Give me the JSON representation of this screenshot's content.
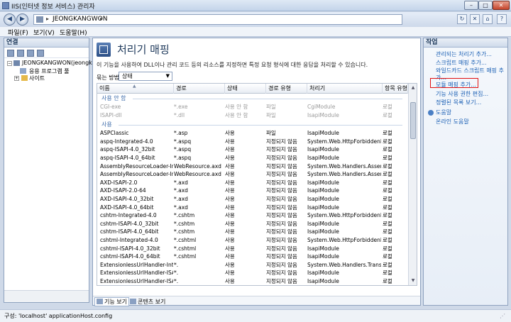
{
  "window": {
    "title": "IIS(인터넷 정보 서비스) 관리자"
  },
  "address": {
    "path": "JEONGKANGWON"
  },
  "menu": [
    "파일(F)",
    "보기(V)",
    "도움말(H)"
  ],
  "connections": {
    "header": "연결",
    "server": "JEONGKANGWON(jeongkang",
    "app_pools": "응용 프로그램 풀",
    "sites": "사이트"
  },
  "page": {
    "title": "처리기 매핑",
    "description": "이 기능을 사용하여 DLL이나 관리 코드 등의 리소스를 지정하면 특정 요청 형식에 대한 응답을 처리할 수 있습니다.",
    "group_label": "묶는 방법:",
    "group_value": "상태"
  },
  "grid": {
    "columns": [
      "이름",
      "경로",
      "상태",
      "경로 유형",
      "처리기",
      "항목 유형"
    ],
    "groups": [
      {
        "label": "사용 안 함",
        "disabled": true,
        "rows": [
          [
            "CGI-exe",
            "*.exe",
            "사용 안 함",
            "파일",
            "CgiModule",
            "로컬"
          ],
          [
            "ISAPI-dll",
            "*.dll",
            "사용 안 함",
            "파일",
            "IsapiModule",
            "로컬"
          ]
        ]
      },
      {
        "label": "사용",
        "disabled": false,
        "rows": [
          [
            "ASPClassic",
            "*.asp",
            "사용",
            "파일",
            "IsapiModule",
            "로컬"
          ],
          [
            "aspq-Integrated-4.0",
            "*.aspq",
            "사용",
            "지정되지 않음",
            "System.Web.HttpForbiddenH...",
            "로컬"
          ],
          [
            "aspq-ISAPI-4.0_32bit",
            "*.aspq",
            "사용",
            "지정되지 않음",
            "IsapiModule",
            "로컬"
          ],
          [
            "aspq-ISAPI-4.0_64bit",
            "*.aspq",
            "사용",
            "지정되지 않음",
            "IsapiModule",
            "로컬"
          ],
          [
            "AssemblyResourceLoader-Inte...",
            "WebResource.axd",
            "사용",
            "지정되지 않음",
            "System.Web.Handlers.Assem...",
            "로컬"
          ],
          [
            "AssemblyResourceLoader-Inte...",
            "WebResource.axd",
            "사용",
            "지정되지 않음",
            "System.Web.Handlers.Assem...",
            "로컬"
          ],
          [
            "AXD-ISAPI-2.0",
            "*.axd",
            "사용",
            "지정되지 않음",
            "IsapiModule",
            "로컬"
          ],
          [
            "AXD-ISAPI-2.0-64",
            "*.axd",
            "사용",
            "지정되지 않음",
            "IsapiModule",
            "로컬"
          ],
          [
            "AXD-ISAPI-4.0_32bit",
            "*.axd",
            "사용",
            "지정되지 않음",
            "IsapiModule",
            "로컬"
          ],
          [
            "AXD-ISAPI-4.0_64bit",
            "*.axd",
            "사용",
            "지정되지 않음",
            "IsapiModule",
            "로컬"
          ],
          [
            "cshtm-Integrated-4.0",
            "*.cshtm",
            "사용",
            "지정되지 않음",
            "System.Web.HttpForbiddenH...",
            "로컬"
          ],
          [
            "cshtm-ISAPI-4.0_32bit",
            "*.cshtm",
            "사용",
            "지정되지 않음",
            "IsapiModule",
            "로컬"
          ],
          [
            "cshtm-ISAPI-4.0_64bit",
            "*.cshtm",
            "사용",
            "지정되지 않음",
            "IsapiModule",
            "로컬"
          ],
          [
            "cshtml-Integrated-4.0",
            "*.cshtml",
            "사용",
            "지정되지 않음",
            "System.Web.HttpForbiddenH...",
            "로컬"
          ],
          [
            "cshtml-ISAPI-4.0_32bit",
            "*.cshtml",
            "사용",
            "지정되지 않음",
            "IsapiModule",
            "로컬"
          ],
          [
            "cshtml-ISAPI-4.0_64bit",
            "*.cshtml",
            "사용",
            "지정되지 않음",
            "IsapiModule",
            "로컬"
          ],
          [
            "ExtensionlessUrlHandler-Integ...",
            "*.",
            "사용",
            "지정되지 않음",
            "System.Web.Handlers.Transfe...",
            "로컬"
          ],
          [
            "ExtensionlessUrlHandler-ISAPI...",
            "*.",
            "사용",
            "지정되지 않음",
            "IsapiModule",
            "로컬"
          ],
          [
            "ExtensionlessUrlHandler-ISAPI...",
            "*.",
            "사용",
            "지정되지 않음",
            "IsapiModule",
            "로컬"
          ]
        ]
      }
    ]
  },
  "view_tabs": {
    "features": "기능 보기",
    "content": "콘텐츠 보기"
  },
  "actions": {
    "header": "작업",
    "items": [
      "관리되는 처리기 추가...",
      "스크립트 매핑 추가...",
      "와일드카드 스크립트 매핑 추",
      "가...",
      "모듈 매핑 추가...",
      "기능 사용 권한 편집...",
      "정렬된 목록 보기...",
      "도움말",
      "온라인 도움말"
    ]
  },
  "status": {
    "text": "구성: 'localhost' applicationHost.config"
  },
  "colors": {
    "link": "#1a5fb4",
    "group": "#3b6aa9",
    "highlight": "#e01010"
  }
}
